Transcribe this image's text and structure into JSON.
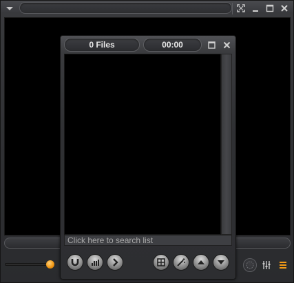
{
  "main_window": {
    "icons": {
      "menu": "chevron-down-icon",
      "fullscreen": "fullscreen-icon",
      "minimize": "minimize-icon",
      "maximize": "maximize-icon",
      "close": "close-icon"
    },
    "volume": 0.88,
    "right_controls": [
      "sparkle-icon",
      "equalizer-icon",
      "playlist-icon"
    ]
  },
  "playlist": {
    "file_count": "0 Files",
    "total_time": "00:00",
    "search_placeholder": "Click here to search list",
    "bottom_buttons": [
      "magnet-icon",
      "bars-icon",
      "forward-icon",
      "grid-icon",
      "wand-icon",
      "up-arrow-icon",
      "down-arrow-icon"
    ]
  },
  "colors": {
    "accent_orange": "#f39a16",
    "chrome_dark": "#2d2e31",
    "video_black": "#000000"
  }
}
